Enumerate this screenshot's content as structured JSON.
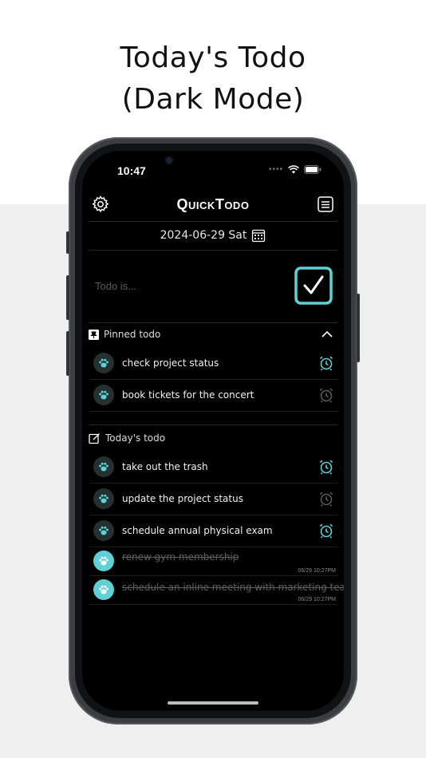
{
  "promo": {
    "line1": "Today's Todo",
    "line2": "(Dark Mode)"
  },
  "status_bar": {
    "time": "10:47",
    "signal_dots": "••••"
  },
  "header": {
    "title": "QuickTodo",
    "settings_icon": "gear-icon",
    "menu_icon": "list-icon"
  },
  "date_bar": {
    "date": "2024-06-29 Sat",
    "icon": "calendar-icon"
  },
  "input": {
    "placeholder": "Todo is...",
    "value": ""
  },
  "pinned": {
    "label": "Pinned todo",
    "items": [
      {
        "text": "check project status",
        "alarm_active": true
      },
      {
        "text": "book tickets for the concert",
        "alarm_active": false
      }
    ]
  },
  "today": {
    "label": "Today's todo",
    "items": [
      {
        "text": "take out the trash",
        "alarm_active": true,
        "done": false
      },
      {
        "text": "update the project status",
        "alarm_active": false,
        "done": false
      },
      {
        "text": "schedule annual physical exam",
        "alarm_active": true,
        "done": false
      },
      {
        "text": "renew gym membership",
        "done": true,
        "completed_at": "06/29 10:27PM"
      },
      {
        "text": "schedule an inline meeting with marketing team",
        "done": true,
        "completed_at": "06/29 10:27PM"
      }
    ]
  },
  "colors": {
    "accent": "#5fd1d6",
    "background": "#000000",
    "alarm_inactive": "#5a5a5a"
  }
}
